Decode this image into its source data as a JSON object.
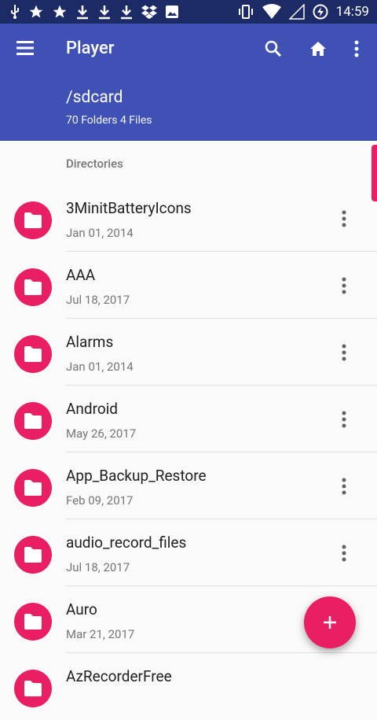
{
  "status_bar": {
    "time": "14:59",
    "icons": [
      "usb-icon",
      "star-icon",
      "star-icon",
      "download-icon",
      "download-icon",
      "download-icon",
      "dropbox-icon",
      "image-icon",
      "vibrate-icon",
      "wifi-icon",
      "signal-icon",
      "battery-charging-icon"
    ]
  },
  "app_bar": {
    "title": "Player",
    "path": "/sdcard",
    "counts": "70 Folders 4 Files",
    "actions": [
      "search-icon",
      "home-icon",
      "more-vert-icon"
    ]
  },
  "section_label": "Directories",
  "items": [
    {
      "name": "3MinitBatteryIcons",
      "date": "Jan 01, 2014"
    },
    {
      "name": "AAA",
      "date": "Jul 18, 2017"
    },
    {
      "name": "Alarms",
      "date": "Jan 01, 2014"
    },
    {
      "name": "Android",
      "date": "May 26, 2017"
    },
    {
      "name": "App_Backup_Restore",
      "date": "Feb 09, 2017"
    },
    {
      "name": "audio_record_files",
      "date": "Jul 18, 2017"
    },
    {
      "name": "Auro",
      "date": "Mar 21, 2017"
    },
    {
      "name": "AzRecorderFree",
      "date": ""
    }
  ],
  "colors": {
    "status_bar": "#1c2a66",
    "primary": "#3f51b5",
    "accent": "#e91e63",
    "background": "#fafafa"
  },
  "fab": {
    "icon": "add-icon"
  }
}
